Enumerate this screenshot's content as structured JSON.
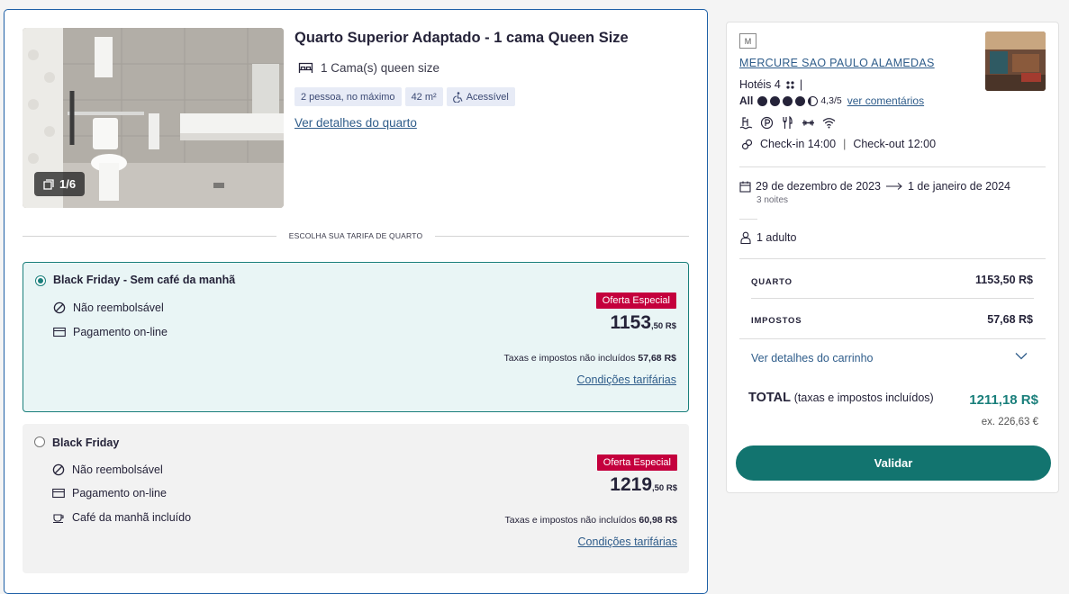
{
  "room": {
    "photo_counter": "1/6",
    "title": "Quarto Superior Adaptado - 1 cama Queen Size",
    "bed": "1 Cama(s) queen size",
    "chips": [
      "2 pessoa, no máximo",
      "42 m²",
      "Acessível"
    ],
    "details_link": "Ver detalhes do quarto"
  },
  "divider_label": "ESCOLHA SUA TARIFA DE QUARTO",
  "rates": [
    {
      "name": "Black Friday - Sem café da manhã",
      "selected": true,
      "features": [
        "Não reembolsável",
        "Pagamento on-line"
      ],
      "badge": "Oferta Especial",
      "price_main": "1153",
      "price_sub": ",50 R$",
      "tax_note_prefix": "Taxas e impostos não incluídos",
      "tax_note_value": "57,68 R$",
      "conditions_link": "Condições tarifárias"
    },
    {
      "name": "Black Friday",
      "selected": false,
      "features": [
        "Não reembolsável",
        "Pagamento on-line",
        "Café da manhã incluído"
      ],
      "badge": "Oferta Especial",
      "price_main": "1219",
      "price_sub": ",50 R$",
      "tax_note_prefix": "Taxas e impostos não incluídos",
      "tax_note_value": "60,98 R$",
      "conditions_link": "Condições tarifárias"
    }
  ],
  "summary": {
    "brand_logo": "M",
    "hotel_name": "MERCURE SAO PAULO ALAMEDAS",
    "category": "Hotéis 4",
    "category_sep": "|",
    "rating_brand": "All",
    "rating_score": "4,3/5",
    "rating_value": 4.3,
    "reviews_link": "ver comentários",
    "amenity_icons": [
      "pool-icon",
      "parking-icon",
      "restaurant-icon",
      "fitness-icon",
      "wifi-icon"
    ],
    "checkin": "Check-in 14:00",
    "checkout": "Check-out 12:00",
    "date_from": "29 de dezembro de 2023",
    "date_to": "1 de janeiro de 2024",
    "nights": "3 noites",
    "guests": "1 adulto",
    "room_label": "QUARTO",
    "room_value": "1153,50 R$",
    "tax_label": "IMPOSTOS",
    "tax_value": "57,68 R$",
    "cart_link": "Ver detalhes do carrinho",
    "total_label": "TOTAL",
    "total_note": "(taxas e impostos incluídos)",
    "total_value": "1211,18 R$",
    "total_alt": "ex. 226,63 €",
    "validate_label": "Validar"
  },
  "colors": {
    "teal": "#1a7f7b",
    "button": "#12746f",
    "badge": "#c4003d",
    "link": "#2e5c8a",
    "card_border": "#1d5fa6"
  }
}
